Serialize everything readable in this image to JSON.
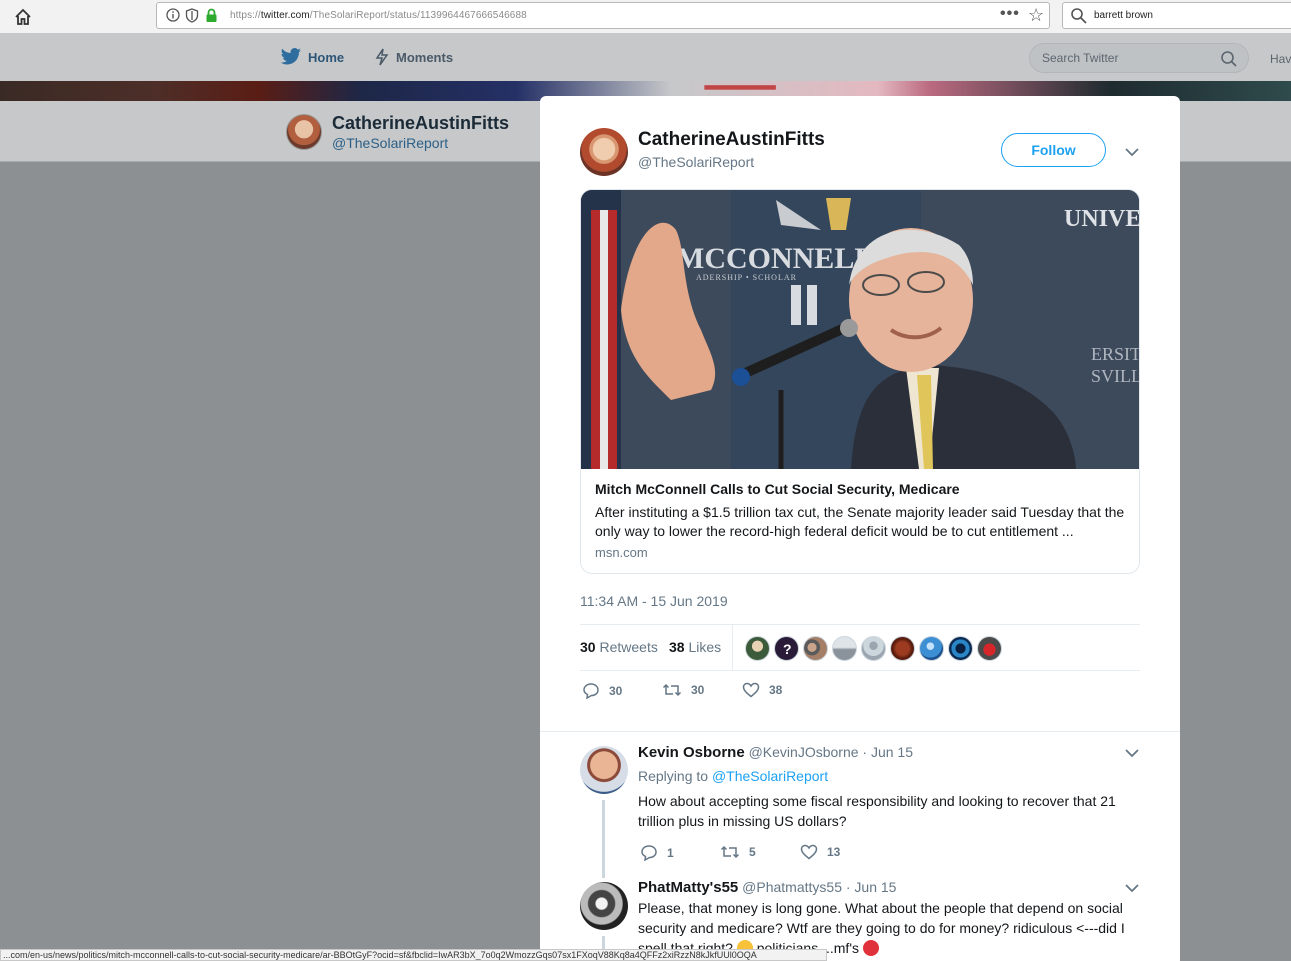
{
  "browser": {
    "url_prefix": "https://",
    "url_domain": "twitter.com",
    "url_path": "/TheSolariReport/status/1139964467666546688",
    "search_query": "barrett brown",
    "status_url": "...com/en-us/news/politics/mitch-mcconnell-calls-to-cut-social-security-medicare/ar-BBOtGyF?ocid=sf&fbclid=IwAR3bX_7o0q2WmozzGqs07sx1FXoqV88Kq8a4QFFz2xiRzzN8kJkfUUl0OQA"
  },
  "twitter_nav": {
    "home_label": "Home",
    "moments_label": "Moments",
    "search_placeholder": "Search Twitter",
    "have_text": "Hav"
  },
  "profile_strip": {
    "name": "CatherineAustinFitts",
    "handle": "@TheSolariReport"
  },
  "tweet": {
    "author_name": "CatherineAustinFitts",
    "author_handle": "@TheSolariReport",
    "follow_label": "Follow",
    "card": {
      "title": "Mitch McConnell Calls to Cut Social Security, Medicare",
      "description": "After instituting a $1.5 trillion tax cut, the Senate majority leader said Tuesday that the only way to lower the record-high federal deficit would be to cut entitlement ...",
      "domain": "msn.com",
      "image_text_1": "MCCONNELL",
      "image_text_2": "UNIVER",
      "image_text_3": "ERSITY",
      "image_text_4": "SVILLE",
      "image_text_5": "ADERSHIP • SCHOLAR"
    },
    "timestamp": "11:34 AM - 15 Jun 2019",
    "retweets_count": "30",
    "retweets_label": "Retweets",
    "likes_count": "38",
    "likes_label": "Likes",
    "action_reply_count": "30",
    "action_retweet_count": "30",
    "action_like_count": "38"
  },
  "replies": [
    {
      "name": "Kevin Osborne",
      "handle": "@KevinJOsborne",
      "date": "· Jun 15",
      "replying_prefix": "Replying to",
      "replying_to": "@TheSolariReport",
      "text": "How about accepting some fiscal responsibility and looking to recover that 21 trillion plus in missing US dollars?",
      "reply_count": "1",
      "retweet_count": "5",
      "like_count": "13"
    },
    {
      "name": "PhatMatty's55",
      "handle": "@Phatmattys55",
      "date": "· Jun 15",
      "text_part1": "Please, that money is long gone. What about the people that depend on social security and medicare? Wtf are they going to do for money? ridiculous <---did I spell that right? ",
      "text_part2": " politicians,...mf's "
    }
  ],
  "colors": {
    "twitter_blue": "#1da1f2",
    "text_secondary": "#657786",
    "overlay_gray": "#8d9093"
  }
}
